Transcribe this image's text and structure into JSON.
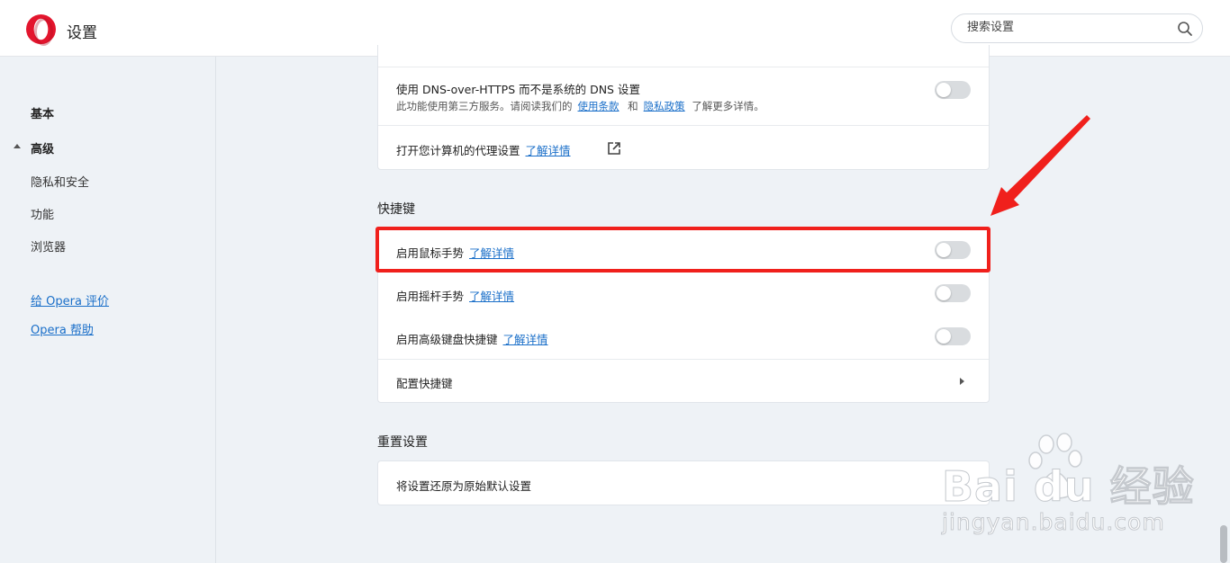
{
  "header": {
    "title": "设置",
    "search_placeholder": "搜索设置"
  },
  "sidebar": {
    "items": [
      {
        "label": "基本"
      },
      {
        "label": "高级"
      },
      {
        "label": "隐私和安全"
      },
      {
        "label": "功能"
      },
      {
        "label": "浏览器"
      }
    ],
    "links": [
      {
        "label": "给 Opera 评价"
      },
      {
        "label": "Opera 帮助"
      }
    ]
  },
  "privacy": {
    "dns_title": "使用 DNS-over-HTTPS 而不是系统的 DNS 设置",
    "dns_sub_prefix": "此功能使用第三方服务。请阅读我们的",
    "dns_terms": "使用条款",
    "dns_and": "和",
    "dns_policy": "隐私政策",
    "dns_sub_suffix": "了解更多详情。",
    "dns_enabled": false,
    "proxy_label": "打开您计算机的代理设置",
    "proxy_link": "了解详情"
  },
  "shortcuts": {
    "section_title": "快捷键",
    "rows": [
      {
        "label": "启用鼠标手势",
        "link": "了解详情",
        "enabled": false
      },
      {
        "label": "启用摇杆手势",
        "link": "了解详情",
        "enabled": false
      },
      {
        "label": "启用高级键盘快捷键",
        "link": "了解详情",
        "enabled": false
      }
    ],
    "configure_label": "配置快捷键"
  },
  "reset": {
    "section_title": "重置设置",
    "restore_label": "将设置还原为原始默认设置"
  },
  "watermark": {
    "brand": "Bai du 经验",
    "url": "jingyan.baidu.com"
  },
  "colors": {
    "accent": "#1a6fc9",
    "highlight": "#f0201c",
    "opera_red": "#e3152d"
  }
}
